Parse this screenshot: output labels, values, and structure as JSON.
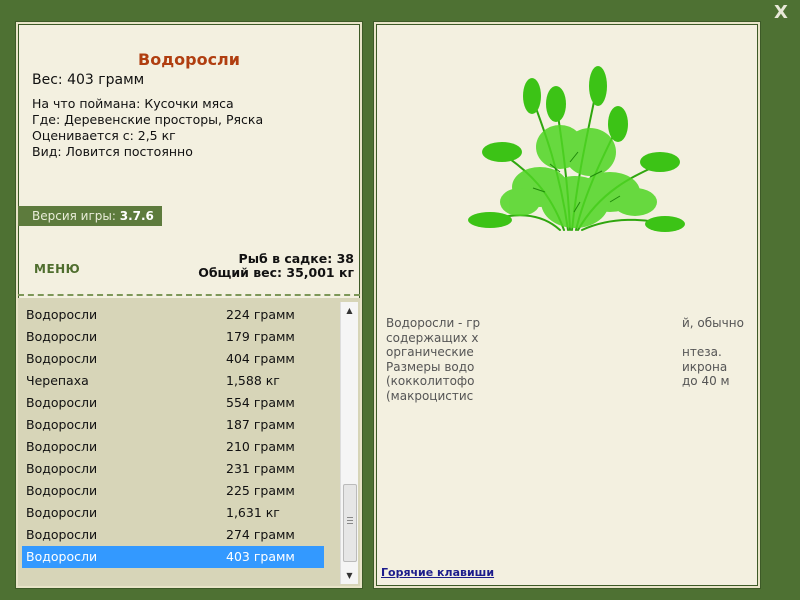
{
  "window": {
    "close_label": "X"
  },
  "fish": {
    "title": "Водоросли",
    "weight": "Вес: 403 грамм",
    "caught_on": "На что поймана: Кусочки мяса",
    "where": "Где: Деревенские просторы, Ряска",
    "valued": "Оценивается с: 2,5 кг",
    "type": "Вид: Ловится постоянно"
  },
  "version": {
    "label": "Версия игры:",
    "number": "3.7.6"
  },
  "menu_label": "МЕНЮ",
  "stats": {
    "fish_count": "Рыб в садке: 38",
    "total_weight": "Общий вес: 35,001 кг"
  },
  "catch_list": [
    {
      "name": "Водоросли",
      "weight": "224 грамм"
    },
    {
      "name": "Водоросли",
      "weight": "179 грамм"
    },
    {
      "name": "Водоросли",
      "weight": "404 грамм"
    },
    {
      "name": "Черепаха",
      "weight": "1,588 кг"
    },
    {
      "name": "Водоросли",
      "weight": "554 грамм"
    },
    {
      "name": "Водоросли",
      "weight": "187 грамм"
    },
    {
      "name": "Водоросли",
      "weight": "210 грамм"
    },
    {
      "name": "Водоросли",
      "weight": "231 грамм"
    },
    {
      "name": "Водоросли",
      "weight": "225 грамм"
    },
    {
      "name": "Водоросли",
      "weight": "1,631 кг"
    },
    {
      "name": "Водоросли",
      "weight": "274 грамм"
    },
    {
      "name": "Водоросли",
      "weight": "403 грамм"
    }
  ],
  "description": {
    "lines": [
      {
        "left": "Водоросли - гр",
        "right": "й, обычно"
      },
      {
        "left": "содержащих х",
        "right": ""
      },
      {
        "left": "органические",
        "right": "нтеза."
      },
      {
        "left": "Размеры водо",
        "right": "икрона"
      },
      {
        "left": "(кокколитофо",
        "right": "до 40 м"
      },
      {
        "left": "(макроцистис",
        "right": ""
      }
    ]
  },
  "hotkeys_label": "Горячие клавиши",
  "colors": {
    "background": "#4e7133",
    "panel": "#f3f0e0",
    "title": "#b03e10",
    "selected": "#3399ff"
  }
}
